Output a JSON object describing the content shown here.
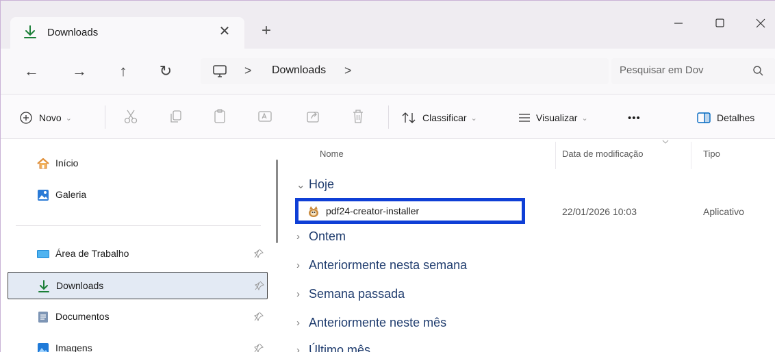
{
  "tab": {
    "title": "Downloads",
    "close_icon": "close-icon",
    "new_tab": "+"
  },
  "window_controls": {
    "minimize": "—",
    "maximize": "▢",
    "close": "✕"
  },
  "nav": {
    "back": "←",
    "forward": "→",
    "up": "↑",
    "refresh": "↻"
  },
  "address": {
    "separator": ">",
    "location": "Downloads",
    "trailing_separator": ">"
  },
  "search": {
    "placeholder": "Pesquisar em Dov"
  },
  "toolbar": {
    "new_label": "Novo",
    "sort_label": "Classificar",
    "view_label": "Visualizar",
    "more_label": "•••",
    "details_label": "Detalhes"
  },
  "sidebar": {
    "items": [
      {
        "label": "Início",
        "icon": "home-icon",
        "pinned": false
      },
      {
        "label": "Galeria",
        "icon": "gallery-icon",
        "pinned": false
      },
      {
        "label": "Área de Trabalho",
        "icon": "desktop-icon",
        "pinned": true
      },
      {
        "label": "Downloads",
        "icon": "download-icon",
        "pinned": true,
        "selected": true
      },
      {
        "label": "Documentos",
        "icon": "documents-icon",
        "pinned": true
      },
      {
        "label": "Imagens",
        "icon": "pictures-icon",
        "pinned": true
      }
    ]
  },
  "columns": {
    "name": "Nome",
    "modified": "Data de modificação",
    "type": "Tipo"
  },
  "groups": [
    {
      "label": "Hoje",
      "expanded": true
    },
    {
      "label": "Ontem",
      "expanded": false
    },
    {
      "label": "Anteriormente nesta semana",
      "expanded": false
    },
    {
      "label": "Semana passada",
      "expanded": false
    },
    {
      "label": "Anteriormente neste mês",
      "expanded": false
    },
    {
      "label": "Último mês",
      "expanded": false
    }
  ],
  "files": [
    {
      "name": "pdf24-creator-installer",
      "modified": "22/01/2026 10:03",
      "type": "Aplicativo",
      "highlight_color": "#0f3fd6"
    }
  ],
  "colors": {
    "accent": "#0067c0",
    "highlight": "#0f3fd6",
    "selected_bg": "#e3eaf4",
    "group_text": "#1f3c6e"
  }
}
